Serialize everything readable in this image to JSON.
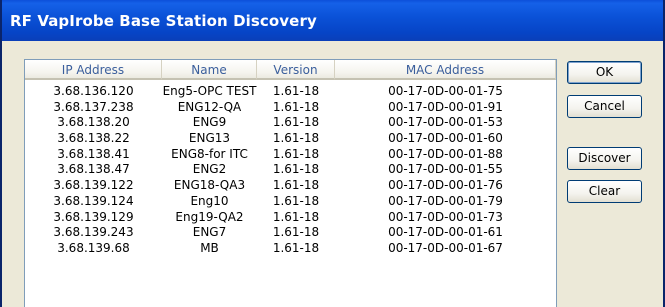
{
  "window": {
    "title": "RF VapIrobe Base Station Discovery"
  },
  "table": {
    "columns": [
      "IP Address",
      "Name",
      "Version",
      "MAC Address"
    ],
    "rows": [
      {
        "ip": "3.68.136.120",
        "name": "Eng5-OPC TEST",
        "version": "1.61-18",
        "mac": "00-17-0D-00-01-75"
      },
      {
        "ip": "3.68.137.238",
        "name": "ENG12-QA",
        "version": "1.61-18",
        "mac": "00-17-0D-00-01-91"
      },
      {
        "ip": "3.68.138.20",
        "name": "ENG9",
        "version": "1.61-18",
        "mac": "00-17-0D-00-01-53"
      },
      {
        "ip": "3.68.138.22",
        "name": "ENG13",
        "version": "1.61-18",
        "mac": "00-17-0D-00-01-60"
      },
      {
        "ip": "3.68.138.41",
        "name": "ENG8-for ITC",
        "version": "1.61-18",
        "mac": "00-17-0D-00-01-88"
      },
      {
        "ip": "3.68.138.47",
        "name": "ENG2",
        "version": "1.61-18",
        "mac": "00-17-0D-00-01-55"
      },
      {
        "ip": "3.68.139.122",
        "name": "ENG18-QA3",
        "version": "1.61-18",
        "mac": "00-17-0D-00-01-76"
      },
      {
        "ip": "3.68.139.124",
        "name": "Eng10",
        "version": "1.61-18",
        "mac": "00-17-0D-00-01-79"
      },
      {
        "ip": "3.68.139.129",
        "name": "Eng19-QA2",
        "version": "1.61-18",
        "mac": "00-17-0D-00-01-73"
      },
      {
        "ip": "3.68.139.243",
        "name": "ENG7",
        "version": "1.61-18",
        "mac": "00-17-0D-00-01-61"
      },
      {
        "ip": "3.68.139.68",
        "name": "MB",
        "version": "1.61-18",
        "mac": "00-17-0D-00-01-67"
      }
    ]
  },
  "buttons": {
    "ok": "OK",
    "cancel": "Cancel",
    "discover": "Discover",
    "clear": "Clear"
  },
  "colors": {
    "title_bar": "#0b52d8",
    "header_text": "#3a5e9c",
    "dialog_bg": "#ece9d8"
  }
}
